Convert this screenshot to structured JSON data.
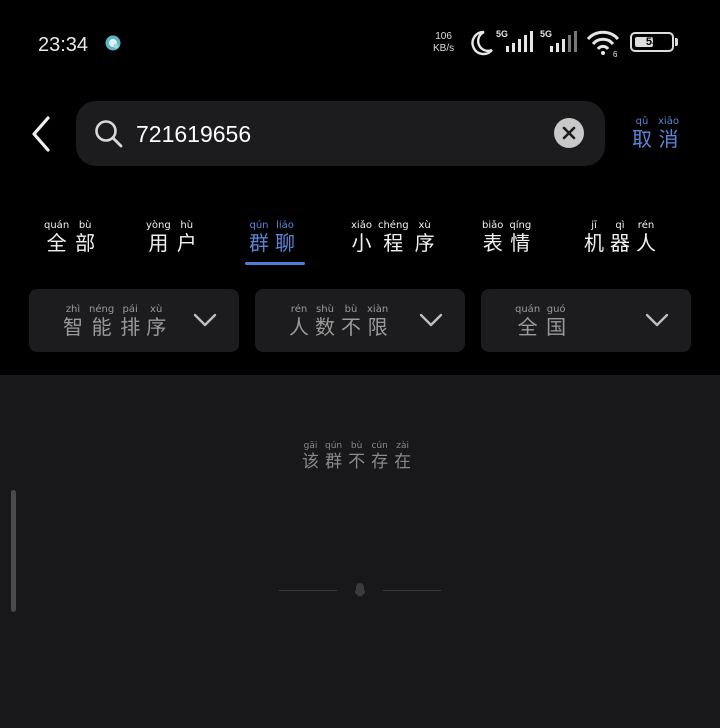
{
  "status_bar": {
    "time": "23:34",
    "network_speed_value": "106",
    "network_speed_unit": "KB/s",
    "sim1_label": "5G",
    "sim2_label": "5G",
    "wifi_label": "6",
    "battery_level": "53",
    "icons": [
      "app-notification-icon",
      "moon-icon",
      "signal-icon",
      "signal-icon",
      "wifi-icon",
      "battery-icon"
    ]
  },
  "search": {
    "query": "721619656",
    "cancel": [
      {
        "py": "qǔ",
        "ch": "取"
      },
      {
        "py": "xiāo",
        "ch": "消"
      }
    ]
  },
  "tabs": [
    {
      "chars": [
        {
          "py": "quán",
          "ch": "全"
        },
        {
          "py": "bù",
          "ch": "部"
        }
      ]
    },
    {
      "chars": [
        {
          "py": "yòng",
          "ch": "用"
        },
        {
          "py": "hù",
          "ch": "户"
        }
      ]
    },
    {
      "chars": [
        {
          "py": "qún",
          "ch": "群"
        },
        {
          "py": "liáo",
          "ch": "聊"
        }
      ],
      "active": true
    },
    {
      "chars": [
        {
          "py": "xiǎo",
          "ch": "小"
        },
        {
          "py": "chéng",
          "ch": "程"
        },
        {
          "py": "xù",
          "ch": "序"
        }
      ]
    },
    {
      "chars": [
        {
          "py": "biǎo",
          "ch": "表"
        },
        {
          "py": "qíng",
          "ch": "情"
        }
      ]
    },
    {
      "chars": [
        {
          "py": "jī",
          "ch": "机"
        },
        {
          "py": "qì",
          "ch": "器"
        },
        {
          "py": "rén",
          "ch": "人"
        }
      ]
    }
  ],
  "filters": [
    {
      "chars": [
        {
          "py": "zhì",
          "ch": "智"
        },
        {
          "py": "néng",
          "ch": "能"
        },
        {
          "py": "pái",
          "ch": "排"
        },
        {
          "py": "xù",
          "ch": "序"
        }
      ]
    },
    {
      "chars": [
        {
          "py": "rén",
          "ch": "人"
        },
        {
          "py": "shù",
          "ch": "数"
        },
        {
          "py": "bù",
          "ch": "不"
        },
        {
          "py": "xiàn",
          "ch": "限"
        }
      ]
    },
    {
      "chars": [
        {
          "py": "quán",
          "ch": "全"
        },
        {
          "py": "guó",
          "ch": "国"
        }
      ]
    }
  ],
  "empty_message": [
    {
      "py": "gāi",
      "ch": "该"
    },
    {
      "py": "qún",
      "ch": "群"
    },
    {
      "py": "bù",
      "ch": "不"
    },
    {
      "py": "cún",
      "ch": "存"
    },
    {
      "py": "zài",
      "ch": "在"
    }
  ],
  "colors": {
    "accent": "#5b86d8",
    "background": "#000000",
    "panel": "#1c1c1e"
  }
}
